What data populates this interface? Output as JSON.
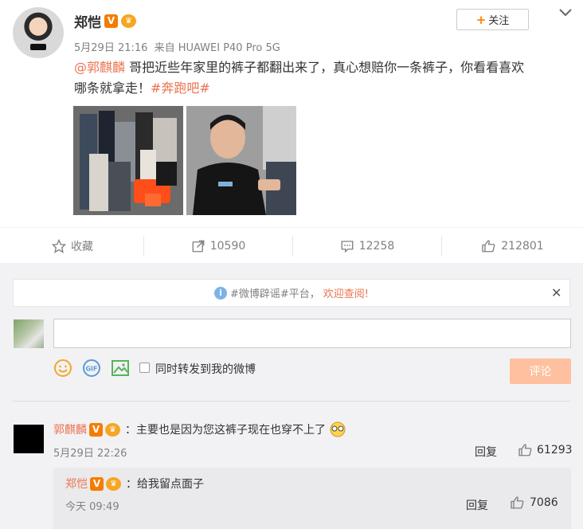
{
  "post": {
    "author": "郑恺",
    "time": "5月29日 21:16",
    "source": "来自 HUAWEI P40 Pro 5G",
    "follow_label": "关注",
    "content_mention": "@郭麒麟",
    "content_line1_rest": " 哥把近些年家里的裤子都翻出来了，真心想赔你一条裤子，你看看喜欢",
    "content_line2": "哪条就拿走！",
    "content_hashtag": "#奔跑吧#"
  },
  "actions": {
    "favorite_label": "收藏",
    "repost_count": "10590",
    "comment_count": "12258",
    "like_count": "212801"
  },
  "comment_area": {
    "notice_prefix": "#微博辟谣#平台，",
    "notice_welcome": "欢迎查阅!",
    "input_value": "",
    "forward_label": "同时转发到我的微博",
    "submit_label": "评论"
  },
  "comments": [
    {
      "author": "郭麒麟",
      "text": "：主要也是因为您这裤子现在也穿不上了",
      "time": "5月29日 22:26",
      "reply_label": "回复",
      "likes": "61293",
      "reply": {
        "author": "郑恺",
        "text": "：给我留点面子",
        "time": "今天 09:49",
        "reply_label": "回复",
        "likes": "7086"
      }
    }
  ],
  "icons": {
    "v_badge": "V",
    "crown_badge": "crown-icon"
  },
  "colors": {
    "accent": "#eb7350",
    "follow_plus": "#ff8200",
    "submit_bg": "#ffc09f",
    "comment_bg": "#f2f2f5"
  }
}
